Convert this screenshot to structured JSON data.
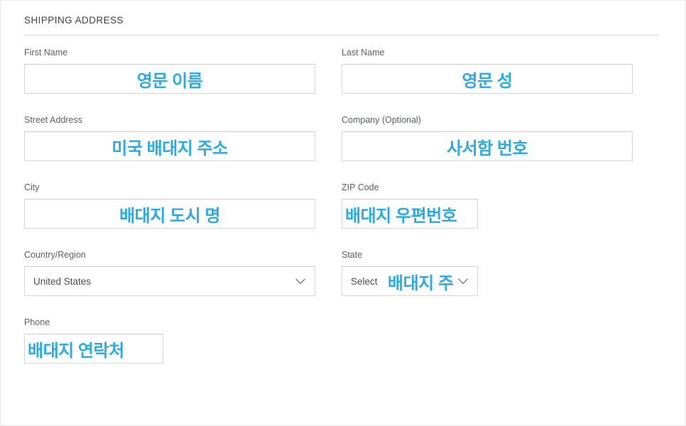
{
  "section": {
    "title": "SHIPPING ADDRESS"
  },
  "colors": {
    "annotation_blue": "#2aaae6",
    "label_gray": "#5d6165",
    "border_gray": "#d7d7d7",
    "value_text": "#4a4e52"
  },
  "fields": {
    "first_name": {
      "label": "First Name",
      "annotation": "영문 이름"
    },
    "last_name": {
      "label": "Last Name",
      "annotation": "영문 성"
    },
    "street_address": {
      "label": "Street Address",
      "annotation": "미국 배대지 주소"
    },
    "company": {
      "label": "Company (Optional)",
      "annotation": "사서함 번호"
    },
    "city": {
      "label": "City",
      "annotation": "배대지 도시 명"
    },
    "zip_code": {
      "label": "ZIP Code",
      "annotation": "배대지 우편번호"
    },
    "country_region": {
      "label": "Country/Region",
      "value": "United States",
      "options": [
        "United States"
      ]
    },
    "state": {
      "label": "State",
      "value": "Select",
      "annotation": "배대지 주"
    },
    "phone": {
      "label": "Phone",
      "annotation": "배대지 연락처"
    }
  }
}
